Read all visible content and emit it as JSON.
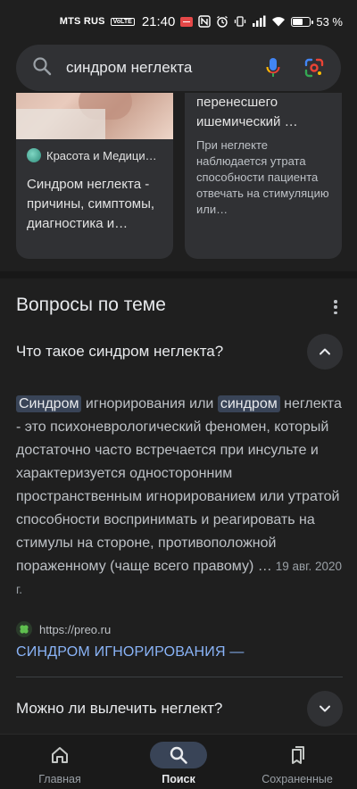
{
  "status_bar": {
    "carrier": "MTS RUS",
    "volte": "VoLTE",
    "time": "21:40",
    "battery": "53 %",
    "battery_level": 0.53
  },
  "search": {
    "query": "синдром неглекта"
  },
  "cards": {
    "left": {
      "source": "Красота и Медици…",
      "title": "Синдром неглекта - причины, симптомы, диагностика и…"
    },
    "right": {
      "title": "перенесшего ишемический …",
      "snippet": "При неглекте наблюдается утрата способности пациента отвечать на стимуляцию или…"
    }
  },
  "questions": {
    "header": "Вопросы по теме",
    "q1": {
      "label": "Что такое синдром неглекта?"
    },
    "answer": {
      "hl1": "Синдром",
      "t1": " игнорирования или ",
      "hl2": "синдром",
      "t2": " неглекта - это психоневрологический феномен, который достаточно часто встречается при инсульте и характеризуется односторонним пространственным игнорированием или утратой способности воспринимать и реагировать на стимулы на стороне, противоположной пораженному (чаще всего правому) …",
      "date": "19 авг. 2020 г."
    },
    "source_url": "https://preo.ru",
    "source_link": "СИНДРОМ ИГНОРИРОВАНИЯ —",
    "q2": {
      "label": "Можно ли вылечить неглект?"
    }
  },
  "bottom_nav": {
    "home": "Главная",
    "search": "Поиск",
    "saved": "Сохраненные"
  },
  "colors": {
    "background": "#1f1f1f",
    "highlight": "#394457",
    "link": "#8ab4f8"
  }
}
